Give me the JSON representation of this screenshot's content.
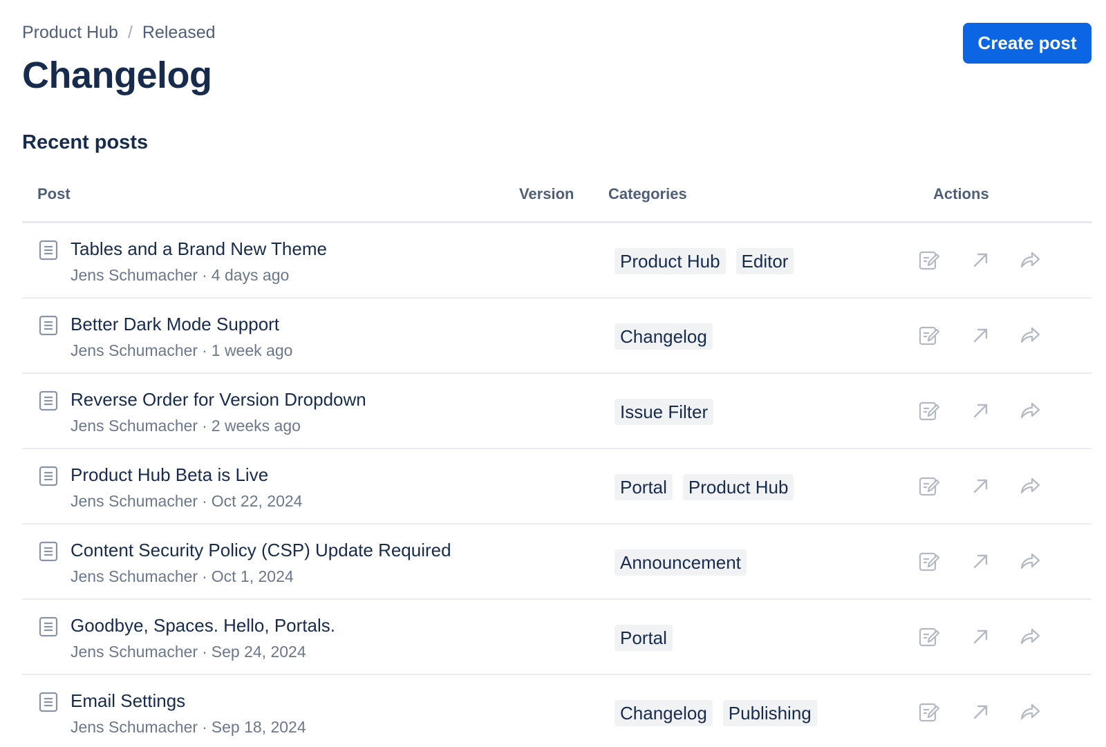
{
  "breadcrumb": {
    "items": [
      "Product Hub",
      "Released"
    ],
    "separator": "/"
  },
  "page_title": "Changelog",
  "create_button": "Create post",
  "section_title": "Recent posts",
  "table": {
    "headers": {
      "post": "Post",
      "version": "Version",
      "categories": "Categories",
      "actions": "Actions"
    },
    "rows": [
      {
        "title": "Tables and a Brand New Theme",
        "author": "Jens Schumacher",
        "time": "4 days ago",
        "version": "",
        "categories": [
          "Product Hub",
          "Editor"
        ]
      },
      {
        "title": "Better Dark Mode Support",
        "author": "Jens Schumacher",
        "time": "1 week ago",
        "version": "",
        "categories": [
          "Changelog"
        ]
      },
      {
        "title": "Reverse Order for Version Dropdown",
        "author": "Jens Schumacher",
        "time": "2 weeks ago",
        "version": "",
        "categories": [
          "Issue Filter"
        ]
      },
      {
        "title": "Product Hub Beta is Live",
        "author": "Jens Schumacher",
        "time": "Oct 22, 2024",
        "version": "",
        "categories": [
          "Portal",
          "Product Hub"
        ]
      },
      {
        "title": "Content Security Policy (CSP) Update Required",
        "author": "Jens Schumacher",
        "time": "Oct 1, 2024",
        "version": "",
        "categories": [
          "Announcement"
        ]
      },
      {
        "title": "Goodbye, Spaces. Hello, Portals.",
        "author": "Jens Schumacher",
        "time": "Sep 24, 2024",
        "version": "",
        "categories": [
          "Portal"
        ]
      },
      {
        "title": "Email Settings",
        "author": "Jens Schumacher",
        "time": "Sep 18, 2024",
        "version": "",
        "categories": [
          "Changelog",
          "Publishing"
        ]
      }
    ]
  },
  "icons": {
    "row": "document-icon",
    "actions": [
      "edit-icon",
      "open-external-icon",
      "share-icon"
    ]
  },
  "colors": {
    "primary": "#0c66e4",
    "text": "#172b4d",
    "subtle_text": "#6b778c",
    "tag_bg": "#f1f2f4",
    "icon": "#b3b9c4"
  }
}
